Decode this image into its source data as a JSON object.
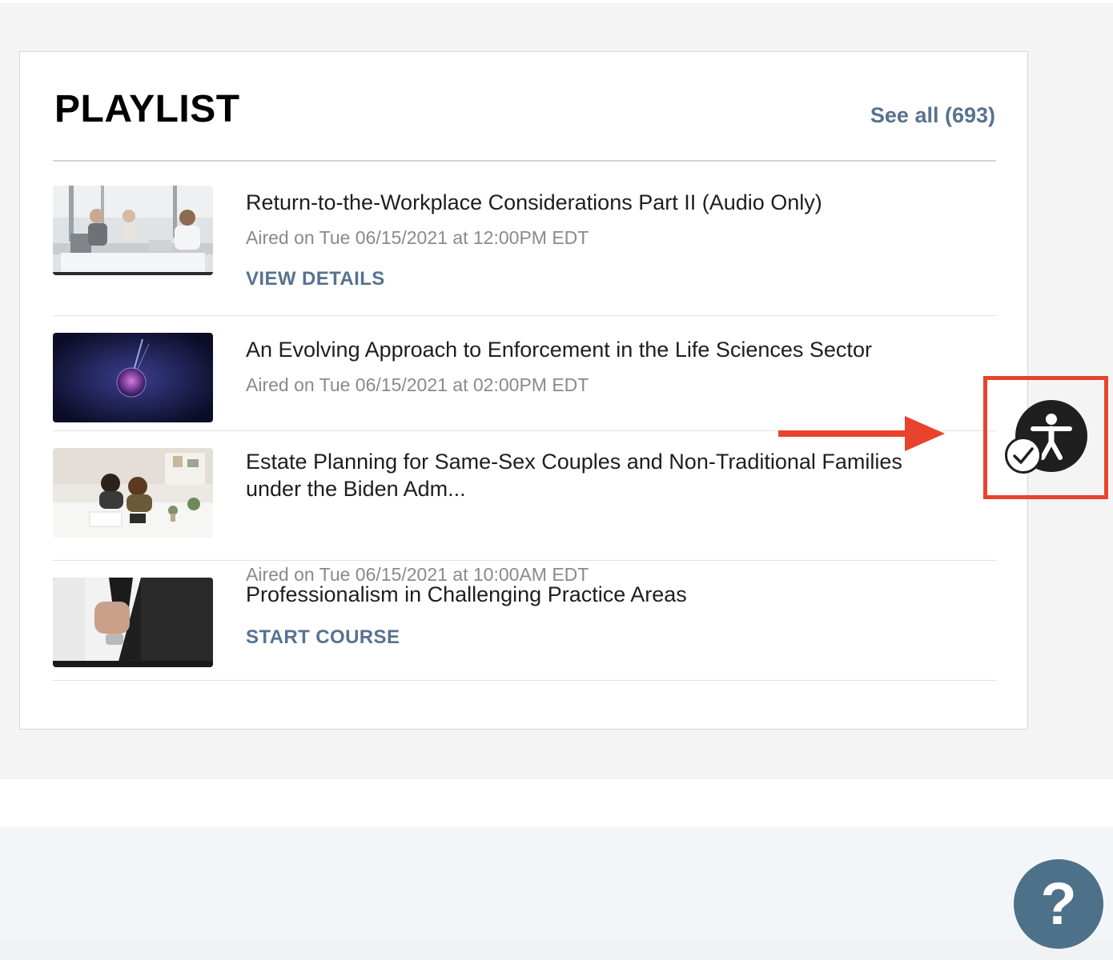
{
  "playlist": {
    "title": "PLAYLIST",
    "see_all_label": "See all (693)",
    "items": [
      {
        "title": "Return-to-the-Workplace Considerations Part II (Audio Only)",
        "date": "Aired on Tue 06/15/2021 at 12:00PM EDT",
        "action": "VIEW DETAILS",
        "thumbnail": "office-meeting-photo"
      },
      {
        "title": "An Evolving Approach to Enforcement in the Life Sciences Sector",
        "date": "Aired on Tue 06/15/2021 at 02:00PM EDT",
        "thumbnail": "plasma-globe-photo"
      },
      {
        "title": "Estate Planning for Same-Sex Couples and Non-Traditional Families under the Biden Adm...",
        "date": "Aired on Tue 06/15/2021 at 10:00AM EDT",
        "thumbnail": "couple-at-table-photo"
      },
      {
        "title": "Professionalism in Challenging Practice Areas",
        "action": "START COURSE",
        "thumbnail": "businessman-tie-photo"
      }
    ]
  },
  "widgets": {
    "accessibility_icon": "accessibility-person-icon",
    "accessibility_status_icon": "checkmark-icon",
    "help_label": "?"
  },
  "colors": {
    "link": "#58728f",
    "highlight": "#e8432d",
    "help_button": "#4d7189"
  }
}
